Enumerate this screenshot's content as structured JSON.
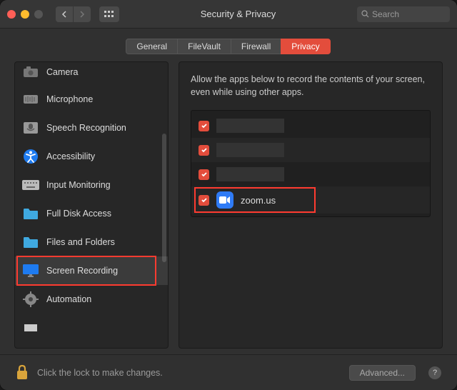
{
  "window": {
    "title": "Security & Privacy",
    "search_placeholder": "Search"
  },
  "tabs": [
    {
      "label": "General",
      "active": false
    },
    {
      "label": "FileVault",
      "active": false
    },
    {
      "label": "Firewall",
      "active": false
    },
    {
      "label": "Privacy",
      "active": true
    }
  ],
  "sidebar": {
    "items": [
      {
        "label": "Camera",
        "icon": "camera"
      },
      {
        "label": "Microphone",
        "icon": "microphone"
      },
      {
        "label": "Speech Recognition",
        "icon": "speech"
      },
      {
        "label": "Accessibility",
        "icon": "accessibility"
      },
      {
        "label": "Input Monitoring",
        "icon": "keyboard"
      },
      {
        "label": "Full Disk Access",
        "icon": "folder"
      },
      {
        "label": "Files and Folders",
        "icon": "folder"
      },
      {
        "label": "Screen Recording",
        "icon": "monitor",
        "selected": true,
        "highlighted": true
      },
      {
        "label": "Automation",
        "icon": "gear"
      }
    ]
  },
  "content": {
    "description": "Allow the apps below to record the contents of your screen, even while using other apps.",
    "apps": [
      {
        "checked": true,
        "redacted": true
      },
      {
        "checked": true,
        "redacted": true
      },
      {
        "checked": true,
        "redacted": true
      },
      {
        "checked": true,
        "name": "zoom.us",
        "icon": "zoom",
        "highlighted": true
      }
    ]
  },
  "footer": {
    "lock_text": "Click the lock to make changes.",
    "advanced_label": "Advanced..."
  }
}
